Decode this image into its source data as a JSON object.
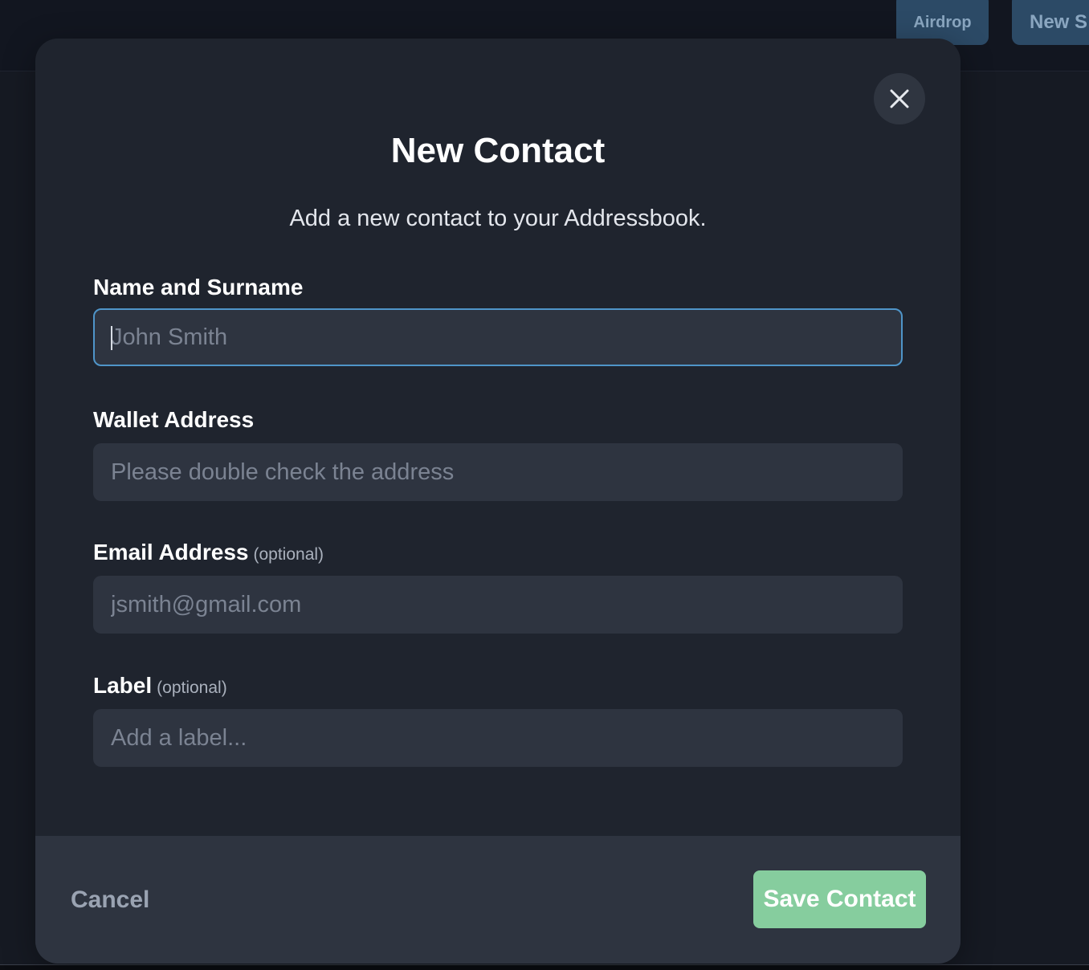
{
  "background": {
    "buttons": [
      "Airdrop",
      "New S"
    ]
  },
  "modal": {
    "title": "New Contact",
    "subtitle": "Add a new contact to your Addressbook.",
    "fields": [
      {
        "label": "Name and Surname",
        "optional": "",
        "placeholder": "John Smith",
        "value": ""
      },
      {
        "label": "Wallet Address",
        "optional": "",
        "placeholder": "Please double check the address",
        "value": ""
      },
      {
        "label": "Email Address",
        "optional": "(optional)",
        "placeholder": "jsmith@gmail.com",
        "value": ""
      },
      {
        "label": "Label",
        "optional": "(optional)",
        "placeholder": "Add a label...",
        "value": ""
      }
    ],
    "footer": {
      "cancel_label": "Cancel",
      "save_label": "Save Contact"
    }
  },
  "colors": {
    "accent_focus": "#4f95c9",
    "save_button": "#86cd9e",
    "modal_bg": "#1f242e"
  },
  "icons": {
    "close": "close-icon"
  }
}
